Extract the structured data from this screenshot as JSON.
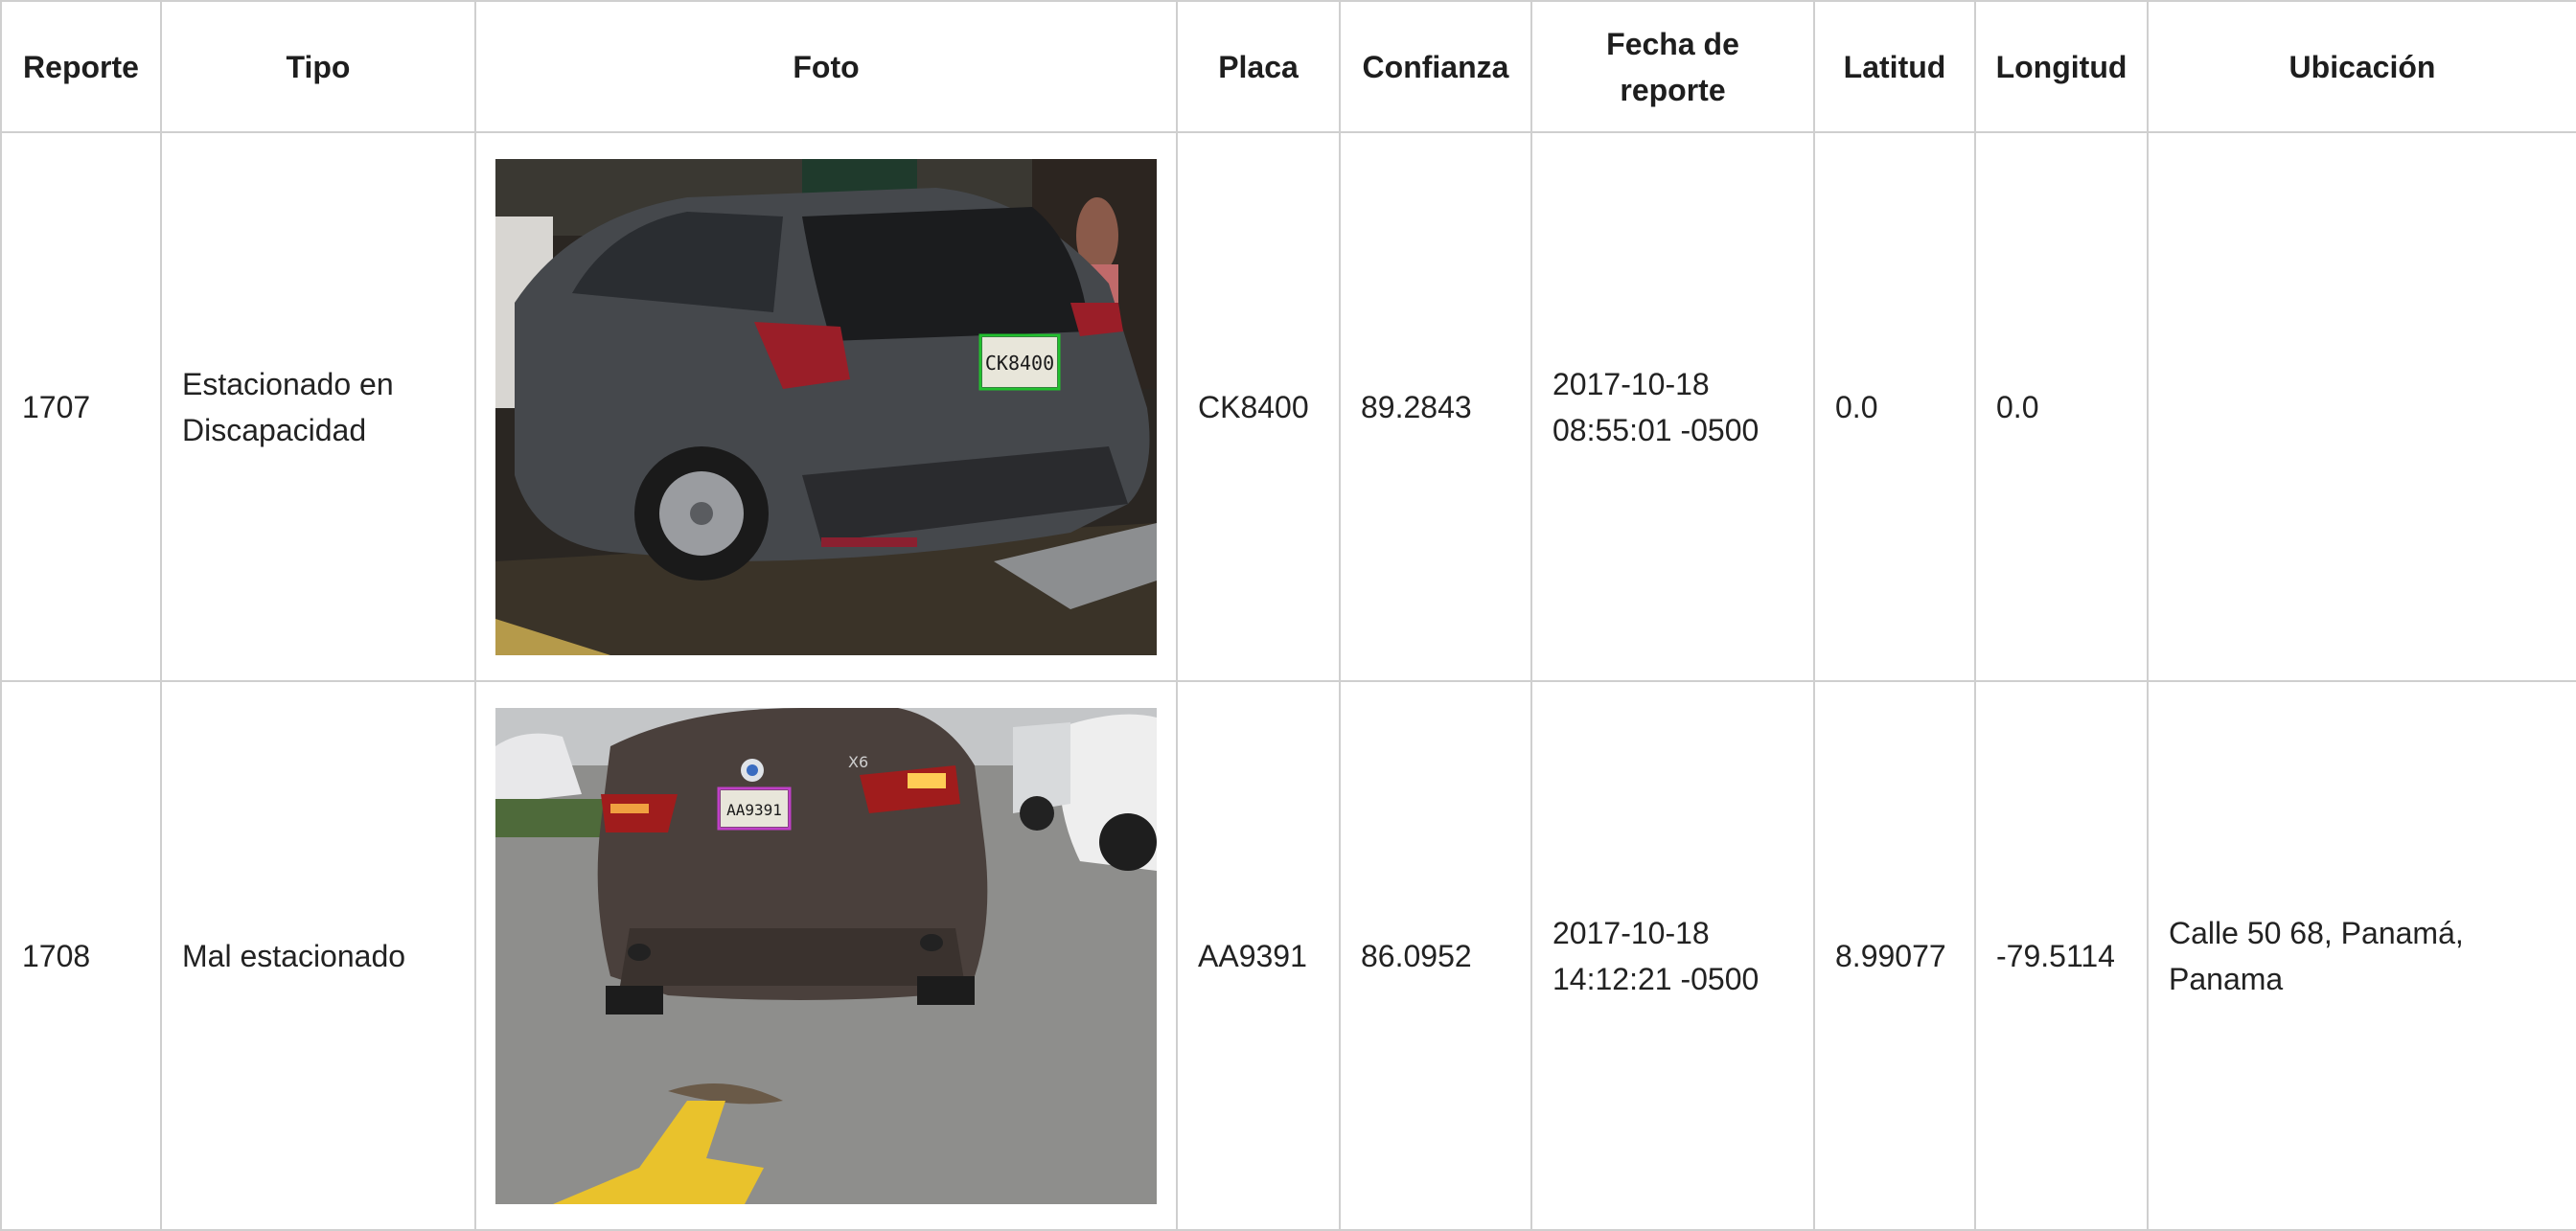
{
  "table": {
    "headers": {
      "reporte": "Reporte",
      "tipo": "Tipo",
      "foto": "Foto",
      "placa": "Placa",
      "confianza": "Confianza",
      "fecha": "Fecha de\nreporte",
      "latitud": "Latitud",
      "longitud": "Longitud",
      "ubicacion": "Ubicación"
    },
    "rows": [
      {
        "reporte": "1707",
        "tipo": "Estacionado en\nDiscapacidad",
        "placa": "CK8400",
        "confianza": "89.2843",
        "fecha": "2017-10-18\n08:55:01 -0500",
        "latitud": "0.0",
        "longitud": "0.0",
        "ubicacion": "",
        "photo": {
          "plate_text": "CK8400",
          "box_color": "#22c02e",
          "car_color": "#45484c"
        }
      },
      {
        "reporte": "1708",
        "tipo": "Mal estacionado",
        "placa": "AA9391",
        "confianza": "86.0952",
        "fecha": "2017-10-18\n14:12:21 -0500",
        "latitud": "8.99077",
        "longitud": "-79.5114",
        "ubicacion": "Calle 50 68, Panamá,\nPanama",
        "photo": {
          "plate_text": "AA9391",
          "model_badge": "X6",
          "box_color": "#c040c8",
          "car_color": "#4a403c"
        }
      }
    ]
  },
  "colors": {
    "border": "#cfcfcf",
    "text": "#222222",
    "header_text": "#1e1e1e"
  }
}
